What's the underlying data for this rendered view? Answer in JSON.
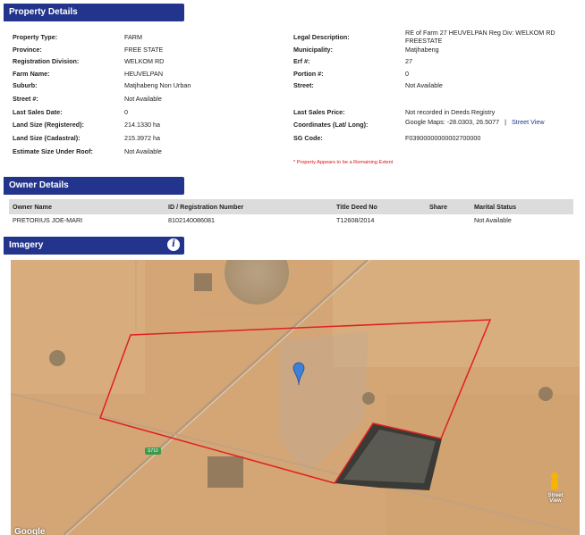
{
  "property": {
    "header": "Property Details",
    "left": [
      {
        "label": "Property Type:",
        "value": "FARM"
      },
      {
        "label": "Province:",
        "value": "FREE STATE"
      },
      {
        "label": "Registration Division:",
        "value": "WELKOM RD"
      },
      {
        "label": "Farm Name:",
        "value": "HEUVELPAN"
      },
      {
        "label": "Suburb:",
        "value": "Matjhabeng Non Urban"
      },
      {
        "label": "Street #:",
        "value": "Not Available"
      },
      {
        "label": "Last Sales Date:",
        "value": "0"
      },
      {
        "label": "Land Size (Registered):",
        "value": "214.1330 ha"
      },
      {
        "label": "Land Size (Cadastral):",
        "value": "215.3972 ha"
      },
      {
        "label": "Estimate Size Under Roof:",
        "value": "Not Available"
      }
    ],
    "right": [
      {
        "label": "Legal Description:",
        "value": "RE of Farm 27 HEUVELPAN Reg Div: WELKOM RD",
        "value2": "FREESTATE"
      },
      {
        "label": "Municipality:",
        "value": "Matjhabeng"
      },
      {
        "label": "Erf #:",
        "value": "27"
      },
      {
        "label": "Portion #:",
        "value": "0"
      },
      {
        "label": "Street:",
        "value": "Not Available"
      },
      {
        "label": "Last Sales Price:",
        "value": "Not recorded in Deeds Registry"
      },
      {
        "label": "Coordinates (Lat/ Long):",
        "value": "Google Maps: -28.0303, 26.5077",
        "sep": "|",
        "link": "Street View"
      },
      {
        "label": "SG Code:",
        "value": "F03900000000002700000"
      }
    ],
    "note": "* Property Appears to be a Remaining Extent"
  },
  "owner": {
    "header": "Owner Details",
    "columns": [
      "Owner Name",
      "ID / Registration Number",
      "Title Deed No",
      "Share",
      "Marital Status"
    ],
    "row": [
      "PRETORIUS JOE-MARI",
      "8102140086081",
      "T12608/2014",
      "",
      "Not Available"
    ]
  },
  "imagery": {
    "header": "Imagery",
    "info_icon": "info-icon",
    "street_view_label": "Street View",
    "google_label": "Google",
    "road_label": "S710",
    "boundary_color": "#e02020",
    "pin_color": "#3f7fd6"
  }
}
